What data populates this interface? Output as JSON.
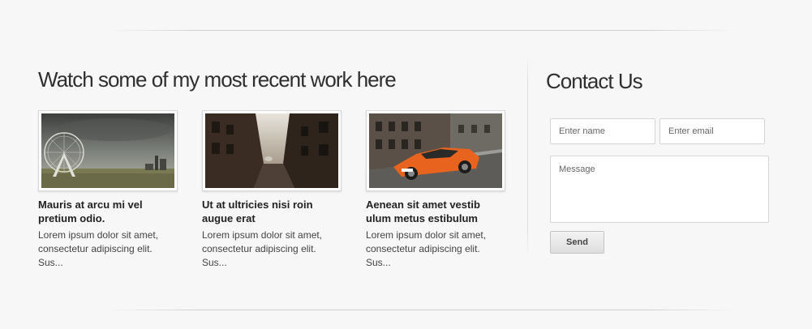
{
  "work": {
    "heading": "Watch some of my most recent work here",
    "items": [
      {
        "image": "london-eye-photo",
        "title": "Mauris at arcu mi vel pretium odio.",
        "excerpt": "Lorem ipsum dolor sit amet, consectetur adipiscing elit. Sus..."
      },
      {
        "image": "street-photo",
        "title": "Ut at ultricies nisi roin augue erat",
        "excerpt": "Lorem ipsum dolor sit amet, consectetur adipiscing elit. Sus..."
      },
      {
        "image": "orange-sports-car-photo",
        "title": "Aenean sit amet vestib ulum metus estibulum",
        "excerpt": "Lorem ipsum dolor sit amet, consectetur adipiscing elit. Sus..."
      }
    ]
  },
  "contact": {
    "heading": "Contact Us",
    "name_placeholder": "Enter name",
    "email_placeholder": "Enter email",
    "message_placeholder": "Message",
    "send_label": "Send"
  }
}
